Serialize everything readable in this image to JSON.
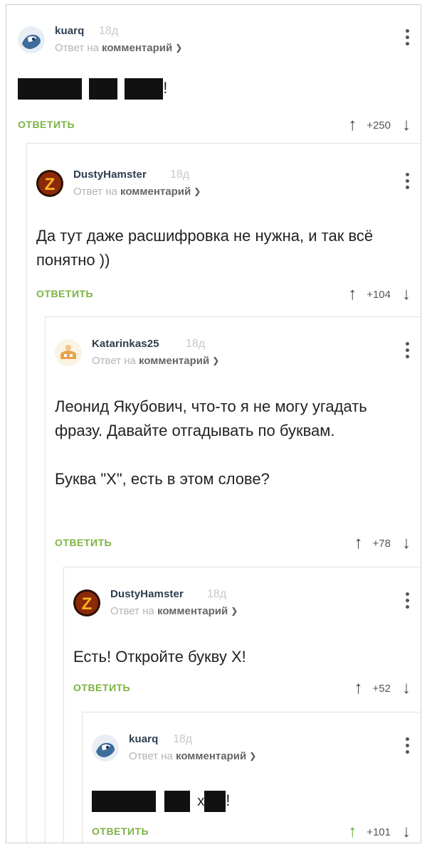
{
  "comments": [
    {
      "username": "kuarq",
      "age": "18д",
      "reply_prefix": "Ответ на",
      "reply_target": "комментарий",
      "text_tail": "!",
      "reply_label": "ОТВЕТИТЬ",
      "score": "+250"
    },
    {
      "username": "DustyHamster",
      "age": "18д",
      "reply_prefix": "Ответ на",
      "reply_target": "комментарий",
      "text": "Да тут даже расшифровка не нужна, и так всё понятно ))",
      "reply_label": "ОТВЕТИТЬ",
      "score": "+104"
    },
    {
      "username": "Katarinkas25",
      "age": "18д",
      "reply_prefix": "Ответ на",
      "reply_target": "комментарий",
      "text_p1": "Леонид Якубович, что-то я не могу угадать фразу. Давайте отгадывать по буквам.",
      "text_p2": "Буква \"Х\", есть в этом слове?",
      "reply_label": "ОТВЕТИТЬ",
      "score": "+78"
    },
    {
      "username": "DustyHamster",
      "age": "18д",
      "reply_prefix": "Ответ на",
      "reply_target": "комментарий",
      "text": "Есть! Откройте букву Х!",
      "reply_label": "ОТВЕТИТЬ",
      "score": "+52"
    },
    {
      "username": "kuarq",
      "age": "18д",
      "reply_prefix": "Ответ на",
      "reply_target": "комментарий",
      "text_letter": "х",
      "text_tail": "!",
      "reply_label": "ОТВЕТИТЬ",
      "score": "+101"
    }
  ],
  "icons": {
    "up": "arrow-up-icon",
    "down": "arrow-down-icon",
    "more": "more-vertical-icon",
    "chevron": "chevron-down-icon"
  },
  "colors": {
    "reply_green": "#7cb342",
    "upvoted_green": "#5fa83a",
    "username": "#2c3e50"
  }
}
